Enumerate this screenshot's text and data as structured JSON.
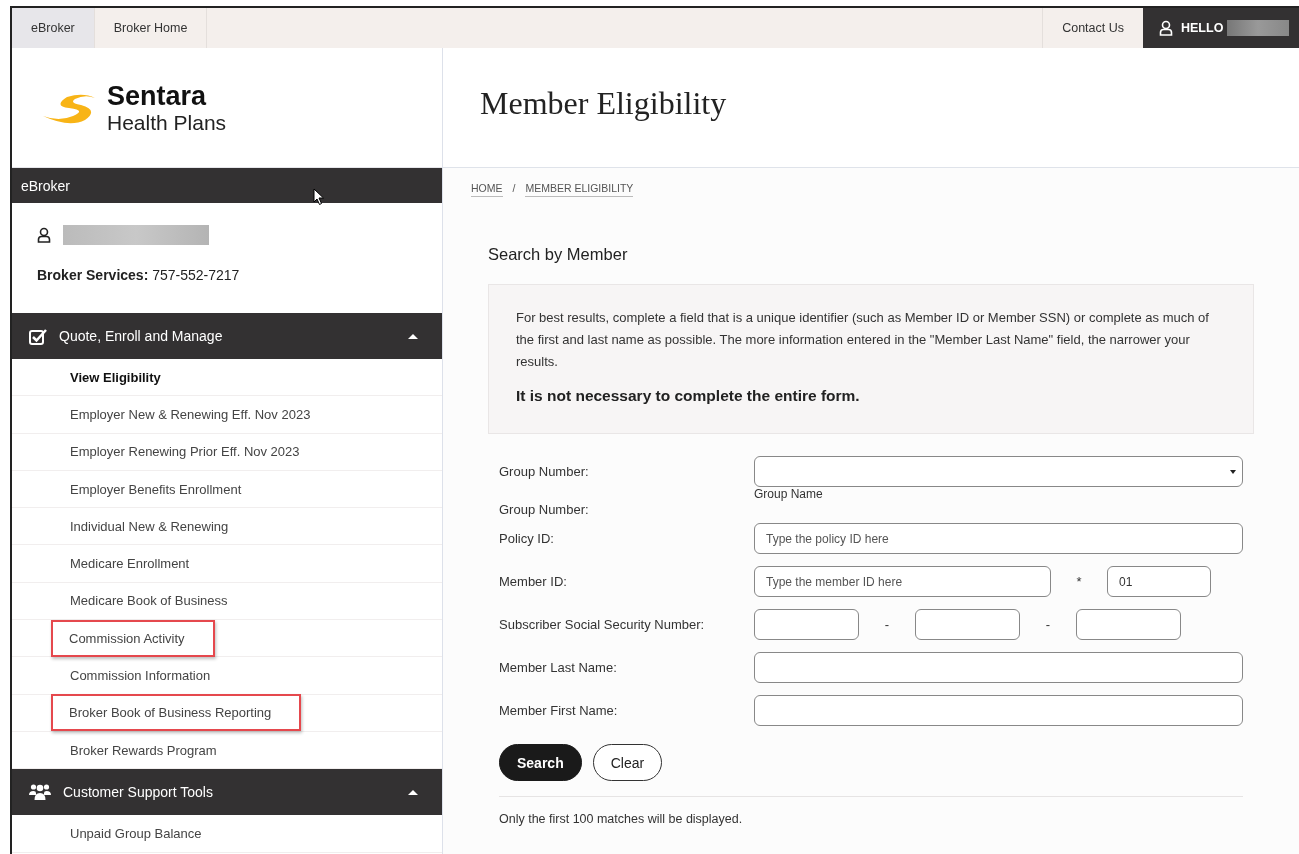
{
  "top_nav": {
    "tabs": [
      {
        "label": "eBroker",
        "selected": true
      },
      {
        "label": "Broker Home",
        "selected": false
      }
    ],
    "contact": "Contact Us",
    "greeting": "HELLO"
  },
  "logo": {
    "name": "Sentara",
    "subtitle": "Health Plans"
  },
  "sidebar": {
    "title": "eBroker",
    "services": "**Broker Services:** 757-552-7217",
    "sections": [
      {
        "title": "Quote, Enroll and Manage",
        "kind": "check",
        "expanded": true,
        "items": [
          {
            "label": "View Eligibility",
            "selected": true,
            "highlighted": false
          },
          {
            "label": "Employer New & Renewing Eff. Nov 2023",
            "selected": false,
            "highlighted": false
          },
          {
            "label": "Employer Renewing Prior Eff. Nov 2023",
            "selected": false,
            "highlighted": false
          },
          {
            "label": "Employer Benefits Enrollment",
            "selected": false,
            "highlighted": false
          },
          {
            "label": "Individual New & Renewing",
            "selected": false,
            "highlighted": false
          },
          {
            "label": "Medicare Enrollment",
            "selected": false,
            "highlighted": false
          },
          {
            "label": "Medicare Book of Business",
            "selected": false,
            "highlighted": false
          },
          {
            "label": "Commission Activity",
            "selected": false,
            "highlighted": true
          },
          {
            "label": "Commission Information",
            "selected": false,
            "highlighted": false
          },
          {
            "label": "Broker Book of Business Reporting",
            "selected": false,
            "highlighted": true
          },
          {
            "label": "Broker Rewards Program",
            "selected": false,
            "highlighted": false
          }
        ]
      },
      {
        "title": "Customer Support Tools",
        "kind": "users",
        "expanded": true,
        "items": [
          {
            "label": "Unpaid Group Balance",
            "selected": false,
            "highlighted": false
          }
        ]
      }
    ]
  },
  "main": {
    "title": "Member Eligibility",
    "breadcrumb": [
      "HOME",
      "MEMBER ELIGIBILITY"
    ],
    "breadcrumb_separator": "/",
    "heading": "Search by Member",
    "info": "For best results, complete a field that is a unique identifier (such as Member ID or Member SSN) or complete as much of the first and last name as possible. The more information entered in the \"Member Last Name\" field, the narrower your results.",
    "info_emphasis": "It is not necessary to complete the entire form.",
    "fields": [
      {
        "kind": "select",
        "label": "Group Number:"
      },
      {
        "kind": "caption",
        "label": "Group Number:",
        "caption": "Group Name"
      },
      {
        "kind": "text",
        "label": "Policy ID:",
        "placeholder": "Type the policy ID here"
      },
      {
        "kind": "member_id",
        "label": "Member ID:",
        "placeholder": "Type the member ID here",
        "separator": "*",
        "suffix": "01"
      },
      {
        "kind": "ssn",
        "label": "Subscriber Social Security Number:",
        "separators": [
          "-",
          "-"
        ]
      },
      {
        "kind": "text",
        "label": "Member Last Name:"
      },
      {
        "kind": "text",
        "label": "Member First Name:"
      }
    ],
    "buttons": [
      {
        "label": "Search",
        "kind": "primary"
      },
      {
        "label": "Clear",
        "kind": "secondary"
      }
    ],
    "note": "Only the first 100 matches will be displayed."
  }
}
